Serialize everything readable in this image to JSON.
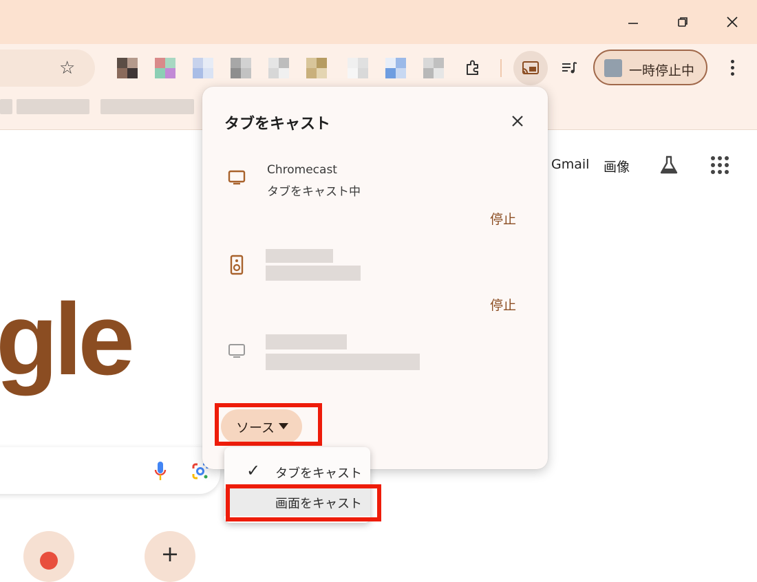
{
  "window": {
    "minimize_icon": "minimize-icon",
    "restore_icon": "restore-icon",
    "close_icon": "close-icon"
  },
  "toolbar": {
    "bookmark_icon": "star-icon",
    "extensions_icon": "puzzle-icon",
    "cast_icon": "cast-icon",
    "media_icon": "media-playlist-icon",
    "profile_button_label": "一時停止中",
    "menu_icon": "more-vert-icon"
  },
  "page": {
    "gmail_link": "Gmail",
    "images_link": "画像",
    "labs_icon": "flask-icon",
    "apps_icon": "apps-grid-icon",
    "logo_text": "gle",
    "mic_icon": "mic-icon",
    "lens_icon": "lens-icon",
    "add_shortcut_label": "+"
  },
  "cast_panel": {
    "title": "タブをキャスト",
    "close_icon": "close-icon",
    "devices": [
      {
        "name": "Chromecast",
        "status": "タブをキャスト中",
        "icon": "tv-icon",
        "stop_label": "停止",
        "active": true
      },
      {
        "name": "",
        "status": "",
        "icon": "speaker-icon",
        "stop_label": "停止",
        "active": true
      },
      {
        "name": "",
        "status": "",
        "icon": "tv-icon",
        "stop_label": "",
        "active": false
      }
    ],
    "source_button": "ソース",
    "source_menu": [
      {
        "label": "タブをキャスト",
        "checked": true
      },
      {
        "label": "画面をキャスト",
        "checked": false
      }
    ]
  },
  "colors": {
    "accent": "#8b4d22",
    "highlight": "#ee1c0a",
    "titlebar": "#fce2d0"
  }
}
